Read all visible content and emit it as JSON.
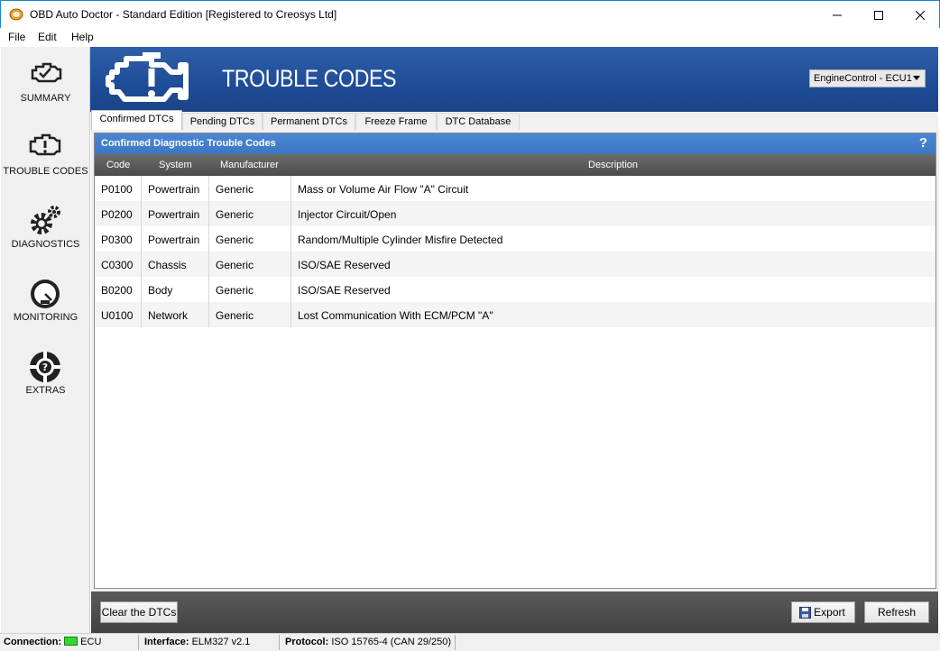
{
  "window": {
    "title": "OBD Auto Doctor - Standard Edition [Registered to Creosys Ltd]",
    "controls": {
      "minimize": "—",
      "maximize": "☐",
      "close": "✕"
    }
  },
  "menu": [
    "File",
    "Edit",
    "Help"
  ],
  "sidebar": {
    "items": [
      {
        "label": "SUMMARY",
        "icon": "engine-check-icon"
      },
      {
        "label": "TROUBLE CODES",
        "icon": "engine-warning-icon"
      },
      {
        "label": "DIAGNOSTICS",
        "icon": "gears-icon"
      },
      {
        "label": "MONITORING",
        "icon": "gauge-icon"
      },
      {
        "label": "EXTRAS",
        "icon": "lifebuoy-question-icon"
      }
    ]
  },
  "header": {
    "title": "TROUBLE CODES",
    "ecu_select": "EngineControl - ECU1"
  },
  "tabs": [
    {
      "label": "Confirmed DTCs",
      "active": true
    },
    {
      "label": "Pending DTCs",
      "active": false
    },
    {
      "label": "Permanent DTCs",
      "active": false
    },
    {
      "label": "Freeze Frame",
      "active": false
    },
    {
      "label": "DTC Database",
      "active": false
    }
  ],
  "panel": {
    "title": "Confirmed Diagnostic Trouble Codes",
    "help": "?",
    "columns": [
      "Code",
      "System",
      "Manufacturer",
      "Description"
    ],
    "rows": [
      {
        "code": "P0100",
        "system": "Powertrain",
        "manufacturer": "Generic",
        "description": "Mass or Volume Air Flow \"A\" Circuit"
      },
      {
        "code": "P0200",
        "system": "Powertrain",
        "manufacturer": "Generic",
        "description": "Injector Circuit/Open"
      },
      {
        "code": "P0300",
        "system": "Powertrain",
        "manufacturer": "Generic",
        "description": "Random/Multiple Cylinder Misfire Detected"
      },
      {
        "code": "C0300",
        "system": "Chassis",
        "manufacturer": "Generic",
        "description": "ISO/SAE Reserved"
      },
      {
        "code": "B0200",
        "system": "Body",
        "manufacturer": "Generic",
        "description": "ISO/SAE Reserved"
      },
      {
        "code": "U0100",
        "system": "Network",
        "manufacturer": "Generic",
        "description": "Lost Communication With ECM/PCM \"A\""
      }
    ]
  },
  "bottom": {
    "clear_label": "Clear the DTCs",
    "export_label": "Export",
    "refresh_label": "Refresh"
  },
  "status": {
    "connection_label": "Connection:",
    "connection_value": "ECU",
    "connection_color": "#2fd82f",
    "interface_label": "Interface:",
    "interface_value": "ELM327 v2.1",
    "protocol_label": "Protocol:",
    "protocol_value": "ISO 15765-4 (CAN 29/250)"
  },
  "colors": {
    "banner": "#1f4c97",
    "panel_header": "#3d77c4",
    "grid_header": "#4a4a4a"
  }
}
